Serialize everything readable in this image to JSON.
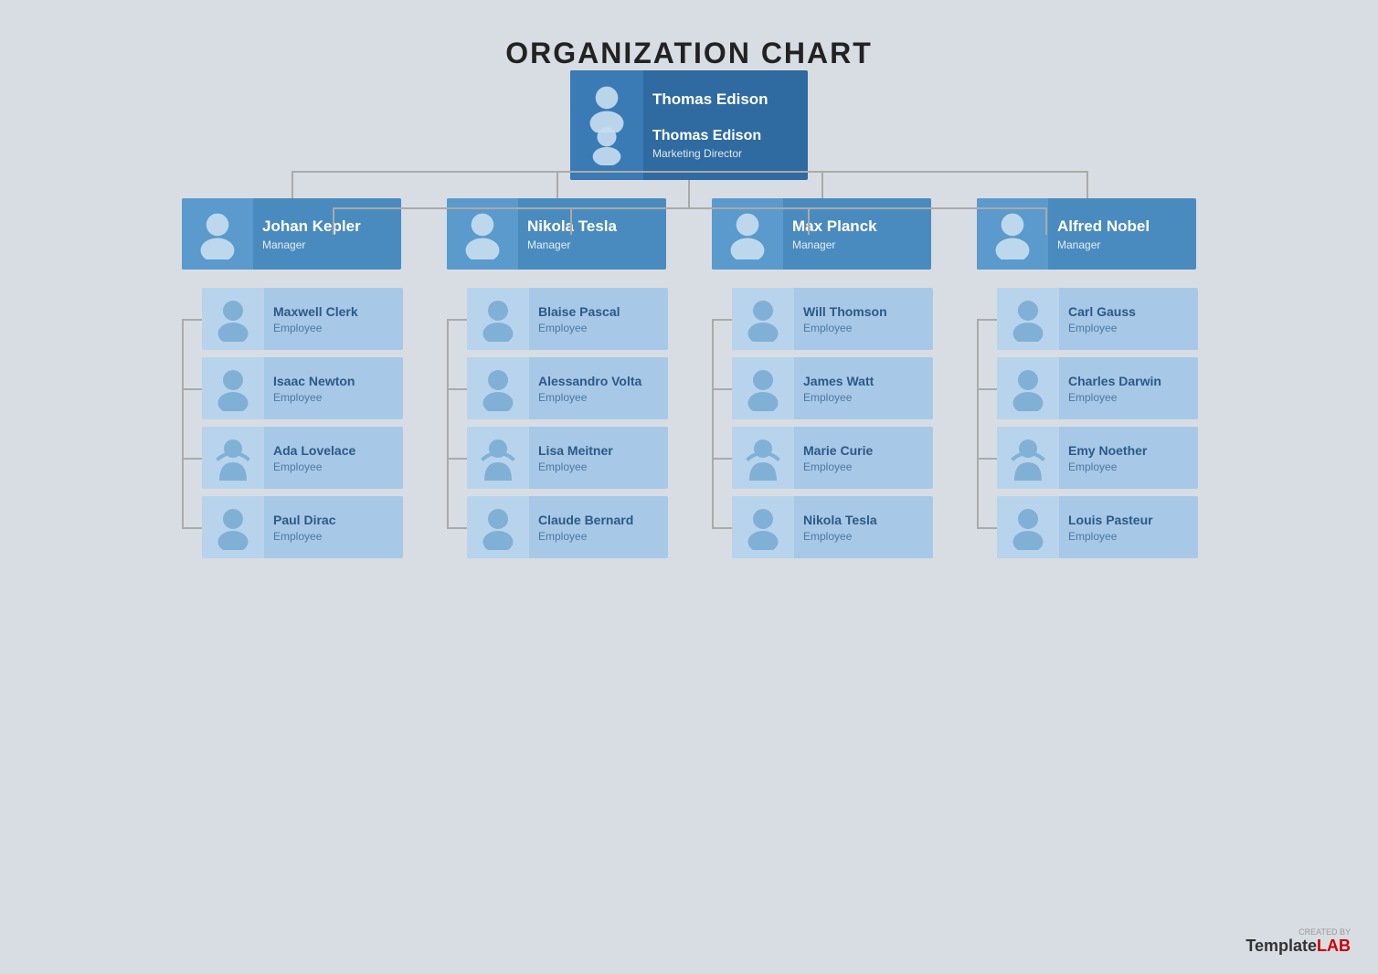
{
  "title": "ORGANIZATION CHART",
  "colors": {
    "bg": "#d8dde3",
    "top_node_bg": "#2f6aa0",
    "top_node_avatar_bg": "#3a7ab5",
    "mgr_node_bg": "#4a8bbf",
    "mgr_node_avatar_bg": "#5a9acc",
    "emp_node_bg": "#a8c8e8",
    "emp_node_avatar_bg": "#b8d4ec",
    "connector": "#aaa"
  },
  "top": {
    "name": "Thomas Edison",
    "role": "Marketing Director"
  },
  "managers": [
    {
      "name": "Johan Kepler",
      "role": "Manager",
      "employees": [
        {
          "name": "Maxwell Clerk",
          "role": "Employee",
          "gender": "male"
        },
        {
          "name": "Isaac Newton",
          "role": "Employee",
          "gender": "male"
        },
        {
          "name": "Ada Lovelace",
          "role": "Employee",
          "gender": "female"
        },
        {
          "name": "Paul Dirac",
          "role": "Employee",
          "gender": "male"
        }
      ]
    },
    {
      "name": "Nikola Tesla",
      "role": "Manager",
      "employees": [
        {
          "name": "Blaise Pascal",
          "role": "Employee",
          "gender": "male"
        },
        {
          "name": "Alessandro Volta",
          "role": "Employee",
          "gender": "male"
        },
        {
          "name": "Lisa Meitner",
          "role": "Employee",
          "gender": "female"
        },
        {
          "name": "Claude Bernard",
          "role": "Employee",
          "gender": "male"
        }
      ]
    },
    {
      "name": "Max Planck",
      "role": "Manager",
      "employees": [
        {
          "name": "Will Thomson",
          "role": "Employee",
          "gender": "male"
        },
        {
          "name": "James Watt",
          "role": "Employee",
          "gender": "male"
        },
        {
          "name": "Marie Curie",
          "role": "Employee",
          "gender": "female"
        },
        {
          "name": "Nikola Tesla",
          "role": "Employee",
          "gender": "male"
        }
      ]
    },
    {
      "name": "Alfred Nobel",
      "role": "Manager",
      "employees": [
        {
          "name": "Carl Gauss",
          "role": "Employee",
          "gender": "male"
        },
        {
          "name": "Charles Darwin",
          "role": "Employee",
          "gender": "male"
        },
        {
          "name": "Emy Noether",
          "role": "Employee",
          "gender": "female"
        },
        {
          "name": "Louis Pasteur",
          "role": "Employee",
          "gender": "male"
        }
      ]
    }
  ],
  "watermark": {
    "created_by": "CREATED BY",
    "brand_template": "Template",
    "brand_lab": "LAB"
  }
}
